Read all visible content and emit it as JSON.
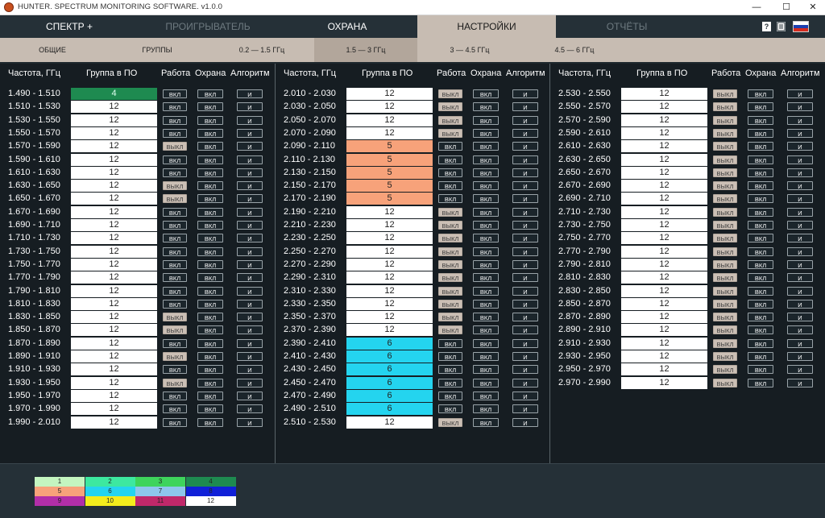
{
  "window": {
    "title": "HUNTER. SPECTRUM MONITORING SOFTWARE. v1.0.0",
    "controls": [
      "—",
      "☐",
      "✕"
    ]
  },
  "main_tabs": [
    "СПЕКТР +",
    "ПРОИГРЫВАТЕЛЬ",
    "ОХРАНА",
    "НАСТРОЙКИ",
    "ОТЧЁТЫ"
  ],
  "active_main_tab": "НАСТРОЙКИ",
  "nav_icons": [
    "help-icon",
    "document-icon",
    "russian-flag-icon"
  ],
  "help_label": "?",
  "sub_tabs": [
    "ОБЩИЕ",
    "ГРУППЫ",
    "0.2 — 1.5 ГГц",
    "1.5 — 3 ГГц",
    "3 — 4.5 ГГц",
    "4.5 — 6 ГГц"
  ],
  "active_sub_tab": "1.5 — 3 ГГц",
  "headers": {
    "freq": "Частота, ГГц",
    "group": "Группа в ПО",
    "work": "Работа",
    "guard": "Охрана",
    "algo": "Алгоритм"
  },
  "button_labels": {
    "on": "ВКЛ",
    "off": "ВЫКЛ",
    "algo": "И"
  },
  "group_colors": {
    "1": "#c4f5c0",
    "2": "#3de8a0",
    "3": "#3ed45c",
    "4": "#1e8a50",
    "5": "#f7a27a",
    "6": "#24d4ef",
    "7": "#8ec6ec",
    "8": "#1020d8",
    "9": "#b22ea8",
    "10": "#f4ec1c",
    "11": "#c0286a",
    "12": "#ffffff"
  },
  "legend": [
    "1",
    "2",
    "3",
    "4",
    "5",
    "6",
    "7",
    "8",
    "9",
    "10",
    "11",
    "12"
  ],
  "tables": [
    {
      "rows": [
        {
          "freq": "1.490 - 1.510",
          "group": "4",
          "work": "on"
        },
        {
          "freq": "1.510 - 1.530",
          "group": "12",
          "work": "on"
        },
        {
          "freq": "1.530 - 1.550",
          "group": "12",
          "work": "on"
        },
        {
          "freq": "1.550 - 1.570",
          "group": "12",
          "work": "on"
        },
        {
          "freq": "1.570 - 1.590",
          "group": "12",
          "work": "off"
        },
        {
          "freq": "1.590 - 1.610",
          "group": "12",
          "work": "on"
        },
        {
          "freq": "1.610 - 1.630",
          "group": "12",
          "work": "on"
        },
        {
          "freq": "1.630 - 1.650",
          "group": "12",
          "work": "off"
        },
        {
          "freq": "1.650 - 1.670",
          "group": "12",
          "work": "off"
        },
        {
          "freq": "1.670 - 1.690",
          "group": "12",
          "work": "on"
        },
        {
          "freq": "1.690 - 1.710",
          "group": "12",
          "work": "on"
        },
        {
          "freq": "1.710 - 1.730",
          "group": "12",
          "work": "on"
        },
        {
          "freq": "1.730 - 1.750",
          "group": "12",
          "work": "on"
        },
        {
          "freq": "1.750 - 1.770",
          "group": "12",
          "work": "on"
        },
        {
          "freq": "1.770 - 1.790",
          "group": "12",
          "work": "on"
        },
        {
          "freq": "1.790 - 1.810",
          "group": "12",
          "work": "on"
        },
        {
          "freq": "1.810 - 1.830",
          "group": "12",
          "work": "on"
        },
        {
          "freq": "1.830 - 1.850",
          "group": "12",
          "work": "off"
        },
        {
          "freq": "1.850 - 1.870",
          "group": "12",
          "work": "off"
        },
        {
          "freq": "1.870 - 1.890",
          "group": "12",
          "work": "on"
        },
        {
          "freq": "1.890 - 1.910",
          "group": "12",
          "work": "off"
        },
        {
          "freq": "1.910 - 1.930",
          "group": "12",
          "work": "on"
        },
        {
          "freq": "1.930 - 1.950",
          "group": "12",
          "work": "off"
        },
        {
          "freq": "1.950 - 1.970",
          "group": "12",
          "work": "on"
        },
        {
          "freq": "1.970 - 1.990",
          "group": "12",
          "work": "on"
        },
        {
          "freq": "1.990 - 2.010",
          "group": "12",
          "work": "on"
        }
      ]
    },
    {
      "rows": [
        {
          "freq": "2.010 - 2.030",
          "group": "12",
          "work": "off"
        },
        {
          "freq": "2.030 - 2.050",
          "group": "12",
          "work": "off"
        },
        {
          "freq": "2.050 - 2.070",
          "group": "12",
          "work": "off"
        },
        {
          "freq": "2.070 - 2.090",
          "group": "12",
          "work": "off"
        },
        {
          "freq": "2.090 - 2.110",
          "group": "5",
          "work": "on"
        },
        {
          "freq": "2.110 - 2.130",
          "group": "5",
          "work": "on"
        },
        {
          "freq": "2.130 - 2.150",
          "group": "5",
          "work": "on"
        },
        {
          "freq": "2.150 - 2.170",
          "group": "5",
          "work": "on"
        },
        {
          "freq": "2.170 - 2.190",
          "group": "5",
          "work": "on"
        },
        {
          "freq": "2.190 - 2.210",
          "group": "12",
          "work": "off"
        },
        {
          "freq": "2.210 - 2.230",
          "group": "12",
          "work": "off"
        },
        {
          "freq": "2.230 - 2.250",
          "group": "12",
          "work": "off"
        },
        {
          "freq": "2.250 - 2.270",
          "group": "12",
          "work": "off"
        },
        {
          "freq": "2.270 - 2.290",
          "group": "12",
          "work": "off"
        },
        {
          "freq": "2.290 - 2.310",
          "group": "12",
          "work": "off"
        },
        {
          "freq": "2.310 - 2.330",
          "group": "12",
          "work": "off"
        },
        {
          "freq": "2.330 - 2.350",
          "group": "12",
          "work": "off"
        },
        {
          "freq": "2.350 - 2.370",
          "group": "12",
          "work": "off"
        },
        {
          "freq": "2.370 - 2.390",
          "group": "12",
          "work": "off"
        },
        {
          "freq": "2.390 - 2.410",
          "group": "6",
          "work": "on"
        },
        {
          "freq": "2.410 - 2.430",
          "group": "6",
          "work": "on"
        },
        {
          "freq": "2.430 - 2.450",
          "group": "6",
          "work": "on"
        },
        {
          "freq": "2.450 - 2.470",
          "group": "6",
          "work": "on"
        },
        {
          "freq": "2.470 - 2.490",
          "group": "6",
          "work": "on"
        },
        {
          "freq": "2.490 - 2.510",
          "group": "6",
          "work": "on"
        },
        {
          "freq": "2.510 - 2.530",
          "group": "12",
          "work": "off"
        }
      ]
    },
    {
      "rows": [
        {
          "freq": "2.530 - 2.550",
          "group": "12",
          "work": "off"
        },
        {
          "freq": "2.550 - 2.570",
          "group": "12",
          "work": "off"
        },
        {
          "freq": "2.570 - 2.590",
          "group": "12",
          "work": "off"
        },
        {
          "freq": "2.590 - 2.610",
          "group": "12",
          "work": "off"
        },
        {
          "freq": "2.610 - 2.630",
          "group": "12",
          "work": "off"
        },
        {
          "freq": "2.630 - 2.650",
          "group": "12",
          "work": "off"
        },
        {
          "freq": "2.650 - 2.670",
          "group": "12",
          "work": "off"
        },
        {
          "freq": "2.670 - 2.690",
          "group": "12",
          "work": "off"
        },
        {
          "freq": "2.690 - 2.710",
          "group": "12",
          "work": "off"
        },
        {
          "freq": "2.710 - 2.730",
          "group": "12",
          "work": "off"
        },
        {
          "freq": "2.730 - 2.750",
          "group": "12",
          "work": "off"
        },
        {
          "freq": "2.750 - 2.770",
          "group": "12",
          "work": "off"
        },
        {
          "freq": "2.770 - 2.790",
          "group": "12",
          "work": "off"
        },
        {
          "freq": "2.790 - 2.810",
          "group": "12",
          "work": "off"
        },
        {
          "freq": "2.810 - 2.830",
          "group": "12",
          "work": "off"
        },
        {
          "freq": "2.830 - 2.850",
          "group": "12",
          "work": "off"
        },
        {
          "freq": "2.850 - 2.870",
          "group": "12",
          "work": "off"
        },
        {
          "freq": "2.870 - 2.890",
          "group": "12",
          "work": "off"
        },
        {
          "freq": "2.890 - 2.910",
          "group": "12",
          "work": "off"
        },
        {
          "freq": "2.910 - 2.930",
          "group": "12",
          "work": "off"
        },
        {
          "freq": "2.930 - 2.950",
          "group": "12",
          "work": "off"
        },
        {
          "freq": "2.950 - 2.970",
          "group": "12",
          "work": "off"
        },
        {
          "freq": "2.970 - 2.990",
          "group": "12",
          "work": "off"
        }
      ]
    }
  ]
}
